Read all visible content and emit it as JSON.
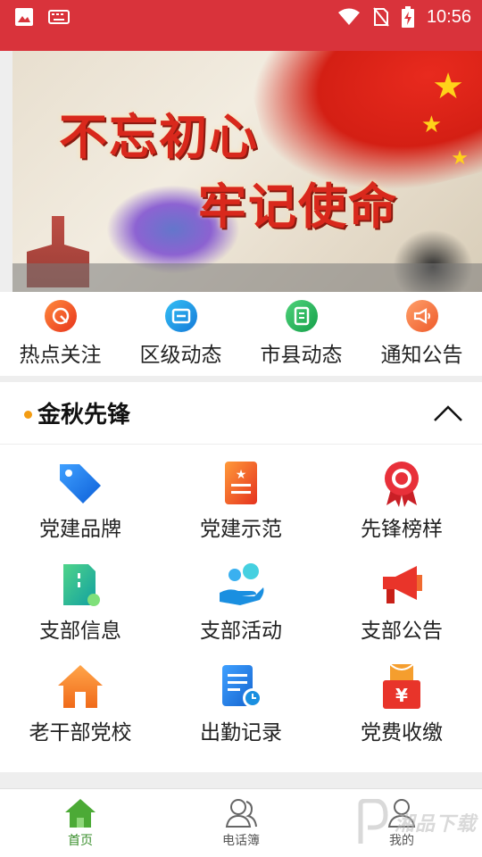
{
  "status_bar": {
    "time": "10:56",
    "icons": [
      "image-icon",
      "keyboard-icon",
      "wifi-icon",
      "no-sim-icon",
      "battery-charging-icon"
    ]
  },
  "banner": {
    "line1": "不忘初心",
    "line2": "牢记使命"
  },
  "quick_nav": [
    {
      "label": "热点关注",
      "icon": "target-icon",
      "color": "#f15a24"
    },
    {
      "label": "区级动态",
      "icon": "card-icon",
      "color": "#1e8ee8"
    },
    {
      "label": "市县动态",
      "icon": "document-icon",
      "color": "#25b35a"
    },
    {
      "label": "通知公告",
      "icon": "megaphone-icon",
      "color": "#f27a3c"
    }
  ],
  "section": {
    "title": "金秋先锋"
  },
  "grid": [
    {
      "label": "党建品牌",
      "icon": "tag-icon"
    },
    {
      "label": "党建示范",
      "icon": "star-document-icon"
    },
    {
      "label": "先锋榜样",
      "icon": "award-ribbon-icon"
    },
    {
      "label": "支部信息",
      "icon": "info-document-icon"
    },
    {
      "label": "支部活动",
      "icon": "hand-people-icon"
    },
    {
      "label": "支部公告",
      "icon": "loudspeaker-icon"
    },
    {
      "label": "老干部党校",
      "icon": "house-icon"
    },
    {
      "label": "出勤记录",
      "icon": "clock-document-icon"
    },
    {
      "label": "党费收缴",
      "icon": "yuan-payment-icon"
    }
  ],
  "tabs": [
    {
      "label": "首页",
      "icon": "home-icon",
      "active": true
    },
    {
      "label": "电话簿",
      "icon": "contacts-icon",
      "active": false
    },
    {
      "label": "我的",
      "icon": "profile-icon",
      "active": false
    }
  ],
  "watermark": {
    "text": "湘品下载"
  }
}
